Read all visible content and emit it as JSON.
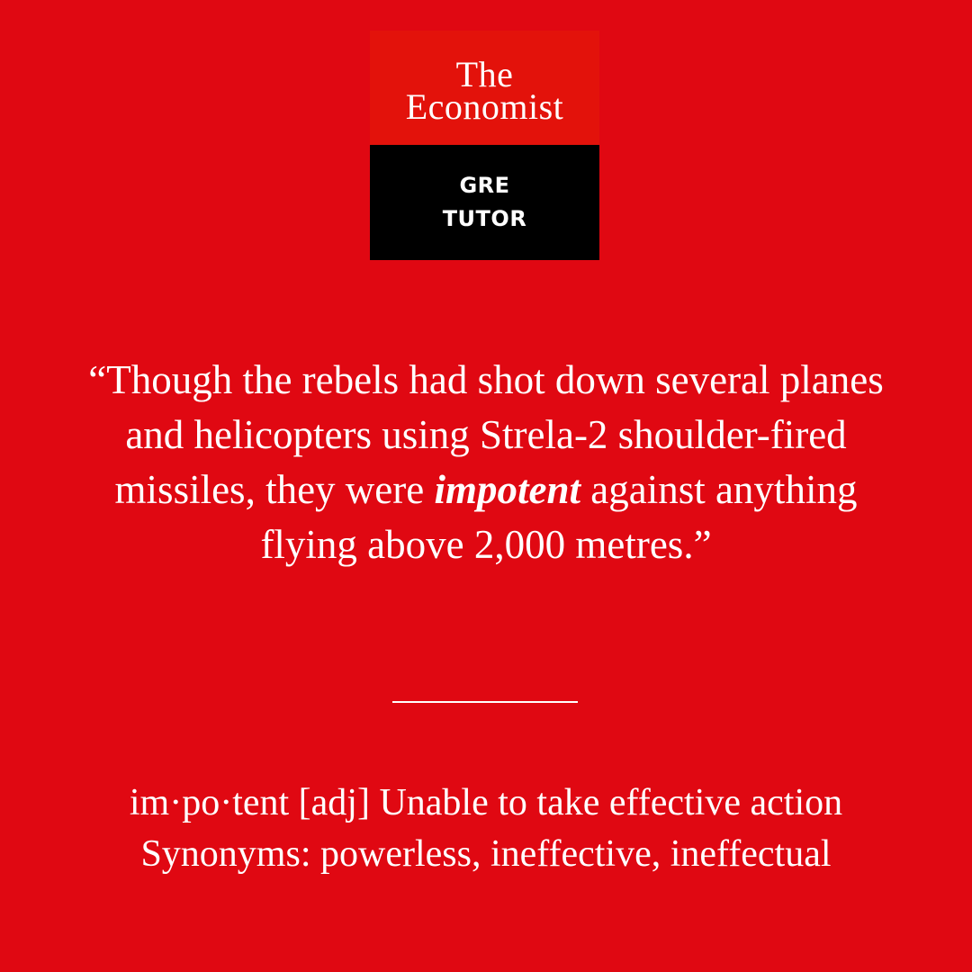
{
  "colors": {
    "background": "#e00812",
    "logo_top": "#e3120b",
    "logo_bottom": "#000000",
    "text": "#ffffff"
  },
  "logo": {
    "title_line1": "The",
    "title_line2": "Economist",
    "sub_line1": "GRE",
    "sub_line2": "TUTOR"
  },
  "quote": {
    "before": "“Though the rebels had shot down several planes and helicopters using Strela-2 shoulder-fired missiles, they were ",
    "word": "impotent",
    "after": " against anything flying above 2,000 metres.”"
  },
  "definition": {
    "line1": "im·po·tent [adj] Unable to take effective action",
    "line2": "Synonyms: powerless, ineffective, ineffectual"
  }
}
